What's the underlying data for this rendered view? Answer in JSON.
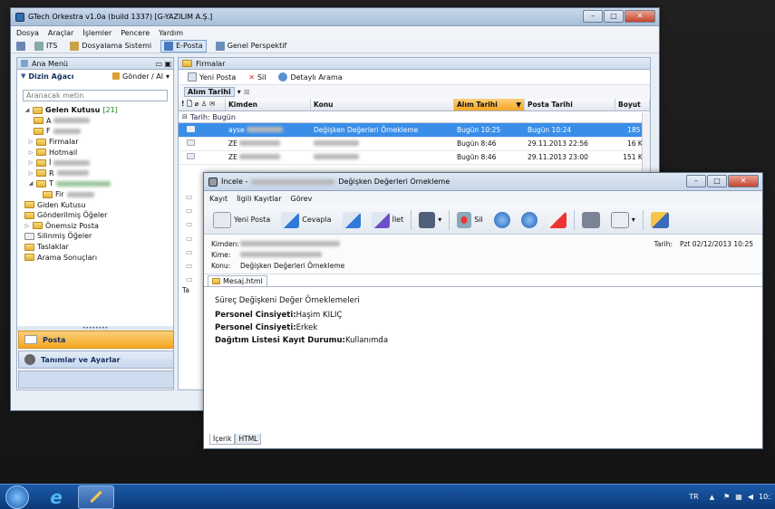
{
  "main_window": {
    "title": "GTech Orkestra v1.0a (build 1337) [G-YAZILIM A.Ş.]",
    "menu": [
      "Dosya",
      "Araçlar",
      "İşlemler",
      "Pencere",
      "Yardım"
    ],
    "perspectives": [
      "ITS",
      "Dosyalama Sistemi",
      "E-Posta",
      "Genel Perspektif"
    ],
    "left_panel_title": "Ana Menü",
    "tree_title": "Dizin Ağacı",
    "send_receive": "Gönder / Al",
    "search_placeholder": "Aranacak metin",
    "inbox_label": "Gelen Kutusu",
    "inbox_count": "[21]",
    "subfolders": [
      "A",
      "F",
      "Firmalar",
      "Hotmail",
      "İ",
      "R",
      "T",
      "Fir"
    ],
    "folders": [
      "Giden Kutusu",
      "Gönderilmiş Öğeler",
      "Önemsiz Posta",
      "Silinmiş Öğeler",
      "Taslaklar",
      "Arama Sonuçları"
    ],
    "nav_posta": "Posta",
    "nav_settings": "Tanımlar ve Ayarlar",
    "right_panel_title": "Firmalar",
    "toolbar": {
      "new_mail": "Yeni Posta",
      "delete": "Sil",
      "search": "Detaylı Arama"
    },
    "group_by": "Alım Tarihi",
    "columns": {
      "from": "Kimden",
      "subject": "Konu",
      "received": "Alım Tarihi",
      "sent": "Posta Tarihi",
      "size": "Boyut"
    },
    "group_label": "Tarih: Bugün",
    "group_label2": "Ta",
    "rows": [
      {
        "from": "ayse",
        "subject": "Değişken Değerleri Örnekleme",
        "received": "Bugün 10:25",
        "sent": "Bugün 10:24",
        "size": "185 B"
      },
      {
        "from": "ZE",
        "subject": "",
        "received": "Bugün 8:46",
        "sent": "29.11.2013 22:56",
        "size": "16 KB"
      },
      {
        "from": "ZE",
        "subject": "",
        "received": "Bugün 8:46",
        "sent": "29.11.2013 23:00",
        "size": "151 KB"
      }
    ]
  },
  "message_window": {
    "title": "İncele - ",
    "title_subject": "Değişken Değerleri Örnekleme",
    "menu": [
      "Kayıt",
      "İlgili Kayıtlar",
      "Görev"
    ],
    "toolbar": {
      "new_mail": "Yeni Posta",
      "reply": "Cevapla",
      "forward": "İlet",
      "delete": "Sil"
    },
    "from_label": "Kimden:",
    "to_label": "Kime:",
    "subject_label": "Konu:",
    "subject_value": "Değişken Değerleri Örnekleme",
    "date_label": "Tarih:",
    "date_value": "Pzt 02/12/2013 10:25",
    "attachment_tab": "Mesaj.html",
    "body_title": "Süreç Değişkeni Değer Örneklemeleri",
    "fields": [
      {
        "label": "Personel Cinsiyeti:",
        "value": "Haşim KILIÇ"
      },
      {
        "label": "Personel Cinsiyeti:",
        "value": "Erkek"
      },
      {
        "label": "Dağıtım Listesi Kayıt Durumu:",
        "value": "Kullanımda"
      }
    ],
    "bottom_tabs": [
      "İçerik",
      "HTML"
    ]
  },
  "taskbar": {
    "lang": "TR",
    "time": "10:25"
  }
}
